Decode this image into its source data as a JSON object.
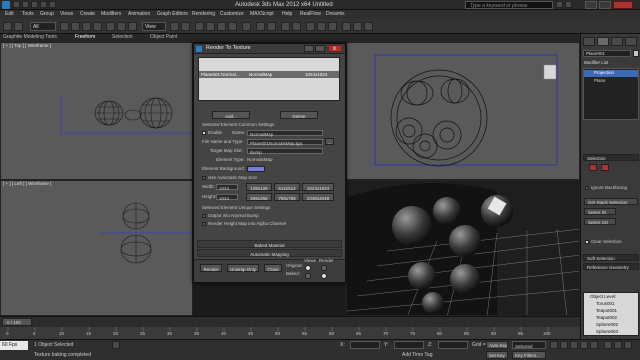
{
  "window": {
    "title": "Autodesk 3ds Max 2012 x64     Untitled",
    "search_placeholder": "Type a keyword or phrase"
  },
  "menu": [
    "Edit",
    "Tools",
    "Group",
    "Views",
    "Create",
    "Modifiers",
    "Animation",
    "Graph Editors",
    "Rendering",
    "Customize",
    "MAXScript",
    "Help",
    "RealFlow",
    "Dreamix"
  ],
  "toolbar": {
    "filter_value": "All",
    "view_value": "View"
  },
  "ribbon": {
    "tabs": [
      "Graphite Modeling Tools",
      "Freeform",
      "Selection",
      "Object Paint"
    ]
  },
  "viewports": {
    "top_left_label": "[ + ] [ Top ] [ Wireframe ]",
    "bottom_left_label": "[ + ] [ Left ] [ Wireframe ]",
    "top_right_label": "",
    "bottom_right_label": ""
  },
  "dialog": {
    "title": "Render To Texture",
    "close_symbol": "x",
    "list_row": {
      "object": "Plane001:Normal...",
      "map": "NormalMap",
      "size": "1024x1024"
    },
    "add_button": "Add...",
    "delete_button": "Delete",
    "common_header": "Selected Element Common Settings",
    "enable_label": "Enable",
    "name_label": "Name:",
    "name_value": "NormalMap",
    "file_label": "File Name and Type:",
    "file_value": "Plane001NormalsMap.tga",
    "browse_label": "...",
    "target_label": "Target Map Slot:",
    "target_value": "Bump",
    "element_type_label": "Element Type:",
    "element_type_value": "NormalsMap",
    "background_label": "Element Background:",
    "auto_size_label": "Use Automatic Map Size",
    "width_label": "Width:",
    "width_value": "1024",
    "height_label": "Height:",
    "height_value": "1024",
    "sizes_row1": [
      "128x128",
      "512x512",
      "1024x1024"
    ],
    "sizes_row2": [
      "256x256",
      "768x768",
      "2048x2048"
    ],
    "unique_header": "Selected Element Unique Settings",
    "output_normal": "Output into Normal Bump",
    "render_height": "Render Height Map into Alpha Channel",
    "baked_material": "Baked Material",
    "auto_mapping": "Automatic Mapping",
    "render_button": "Render",
    "unwrap_button": "Unwrap Only",
    "close_button": "Close",
    "original_label": "Original:",
    "baked_label": "Baked:",
    "views_label": "Views",
    "render_label": "Render"
  },
  "cmdpanel": {
    "object_name": "Plane001",
    "modifier_list": "Modifier List",
    "stack": [
      "Projection",
      "Plane"
    ],
    "selection_header": "Selection",
    "ignore_backfacing": "Ignore Backfacing",
    "get_stack_selection": "Get Stack Selection",
    "select_id": "Select ID",
    "select_sg": "Select SG",
    "clear_selection": "Clear Selection",
    "soft_selection": "Soft Selection",
    "reference_geometry": "Reference Geometry",
    "object_level": "Object Level:",
    "objects": [
      "Torus001",
      "Teapot001",
      "Teapot002",
      "Sphere002",
      "Sphere003"
    ]
  },
  "timeline": {
    "frame": "0 / 100",
    "ticks": [
      "0",
      "5",
      "10",
      "15",
      "20",
      "25",
      "30",
      "35",
      "40",
      "45",
      "50",
      "55",
      "60",
      "65",
      "70",
      "75",
      "80",
      "85",
      "90",
      "95",
      "100"
    ]
  },
  "status": {
    "selected": "1 Object Selected",
    "prompt": "Texture baking completed",
    "fps_badge": "60 Fps",
    "x_label": "X:",
    "y_label": "Y:",
    "z_label": "Z:",
    "grid": "Grid = 1,0cm",
    "auto_key": "Auto Key",
    "selected_mode": "Selected",
    "set_key": "Set Key",
    "key_filters": "Key Filters...",
    "add_time_tag": "Add Time Tag"
  }
}
